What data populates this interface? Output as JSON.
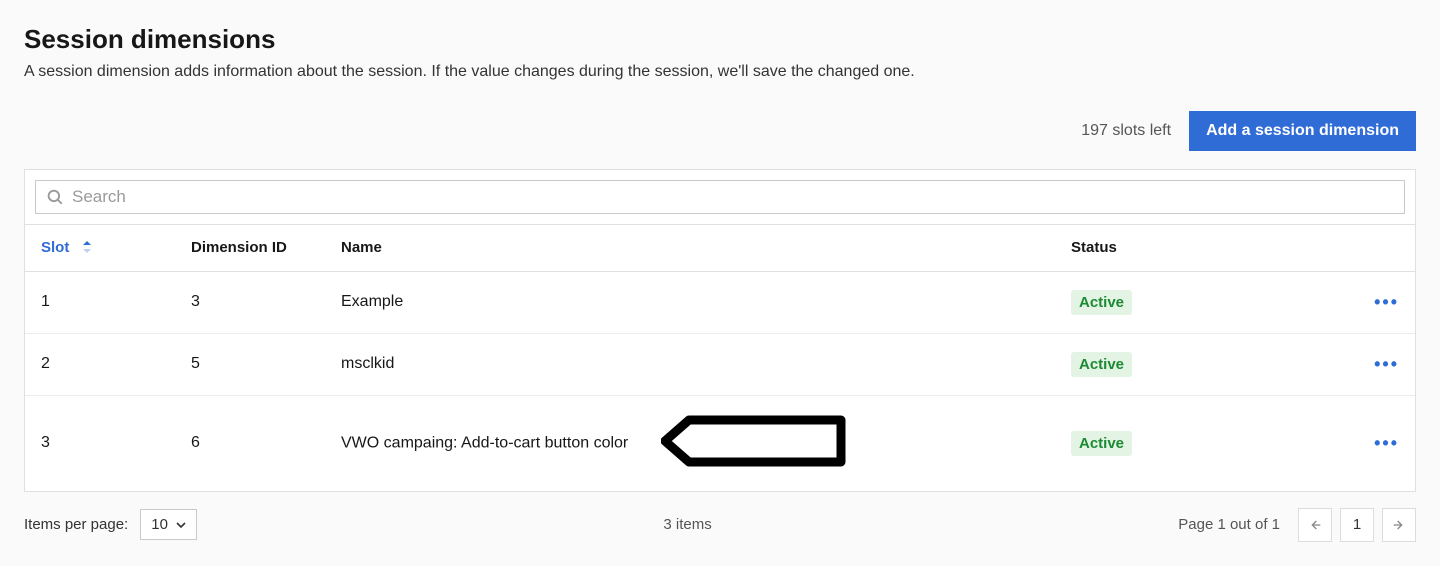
{
  "header": {
    "title": "Session dimensions",
    "subtitle": "A session dimension adds information about the session. If the value changes during the session, we'll save the changed one."
  },
  "top": {
    "slots_left": "197 slots left",
    "add_button": "Add a session dimension"
  },
  "search": {
    "placeholder": "Search"
  },
  "table": {
    "columns": {
      "slot": "Slot",
      "dimension_id": "Dimension ID",
      "name": "Name",
      "status": "Status"
    },
    "rows": [
      {
        "slot": "1",
        "dimension_id": "3",
        "name": "Example",
        "status": "Active"
      },
      {
        "slot": "2",
        "dimension_id": "5",
        "name": "msclkid",
        "status": "Active"
      },
      {
        "slot": "3",
        "dimension_id": "6",
        "name": "VWO campaing: Add-to-cart button color",
        "status": "Active"
      }
    ]
  },
  "footer": {
    "items_per_page_label": "Items per page:",
    "items_per_page_value": "10",
    "items_count": "3 items",
    "page_label": "Page 1 out of 1",
    "current_page": "1"
  }
}
